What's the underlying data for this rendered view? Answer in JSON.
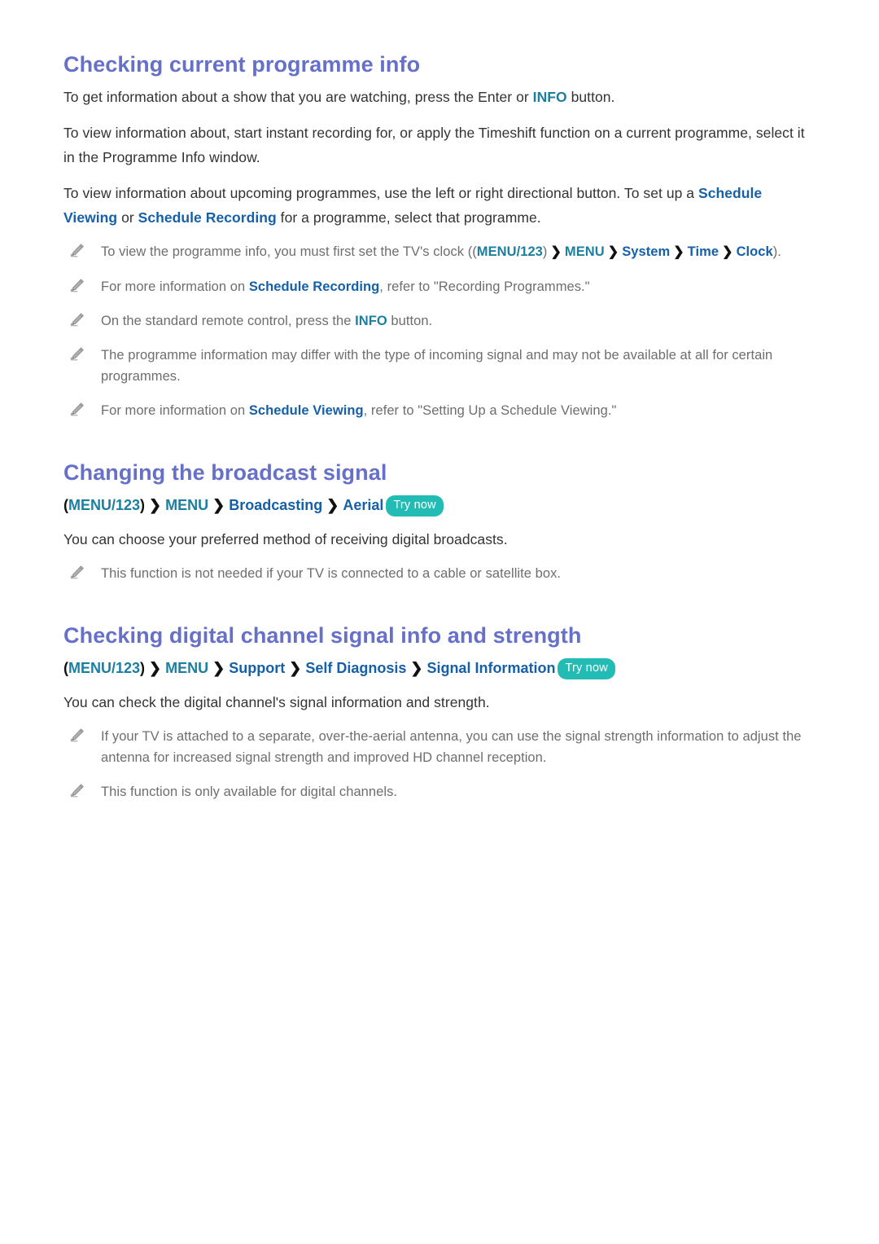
{
  "document": {
    "sections": [
      {
        "id": "checking-current-programme-info",
        "title": "Checking current programme info",
        "paragraphs": [
          "To get information about a show that you are watching, press the Enter or INFO button.",
          "To view information about, start instant recording for, or apply the Timeshift function on a current programme, select it in the Programme Info window.",
          "To view information about upcoming programmes, use the left or right directional button. To set up a Schedule Viewing or Schedule Recording for a programme, select that programme."
        ],
        "p1": {
          "pre": "To get information about a show that you are watching, press the Enter or ",
          "link": "INFO",
          "post": " button."
        },
        "p2": {
          "text": "To view information about, start instant recording for, or apply the Timeshift function on a current programme, select it in the Programme Info window."
        },
        "p3": {
          "pre": "To view information about upcoming programmes, use the left or right directional button. To set up a ",
          "link1": "Schedule Viewing",
          "mid": " or ",
          "link2": "Schedule Recording",
          "post": " for a programme, select that programme."
        },
        "notes": [
          {
            "pre": "To view the programme info, you must first set the TV's clock ((",
            "tok1": "MENU/123",
            "close1": ")",
            "chev1": "❯",
            "tok2": "MENU",
            "chev2": "❯",
            "tok3": "System",
            "chev3": "❯",
            "tok4": "Time",
            "chev4": "❯",
            "tok5": "Clock",
            "post": ")."
          },
          {
            "pre": "For more information on ",
            "link": "Schedule Recording",
            "post": ", refer to \"Recording Programmes.\""
          },
          {
            "pre": "On the standard remote control, press the ",
            "link": "INFO",
            "post": " button."
          },
          {
            "pre": "The programme information may differ with the type of incoming signal and may not be available at all for certain programmes.",
            "link": "",
            "post": ""
          },
          {
            "pre": "For more information on ",
            "link": "Schedule Viewing",
            "post": ", refer to \"Setting Up a Schedule Viewing.\""
          }
        ]
      },
      {
        "id": "changing-the-broadcast-signal",
        "title": "Changing the broadcast signal",
        "menu_path": {
          "open_paren": "(",
          "tokens": [
            "MENU/123",
            "MENU",
            "Broadcasting",
            "Aerial"
          ],
          "close_paren": ")",
          "separator": "❯",
          "try_now": "Try now"
        },
        "paragraph": "You can choose your preferred method of receiving digital broadcasts.",
        "notes": [
          {
            "pre": "This function is not needed if your TV is connected to a cable or satellite box.",
            "link": "",
            "post": ""
          }
        ]
      },
      {
        "id": "checking-digital-channel-signal-info-and-strength",
        "title": "Checking digital channel signal info and strength",
        "menu_path": {
          "open_paren": "(",
          "tokens": [
            "MENU/123",
            "MENU",
            "Support",
            "Self Diagnosis",
            "Signal Information"
          ],
          "close_paren": ")",
          "separator": "❯",
          "try_now": "Try now"
        },
        "paragraph": "You can check the digital channel's signal information and strength.",
        "notes": [
          {
            "pre": "If your TV is attached to a separate, over-the-aerial antenna, you can use the signal strength information to adjust the antenna for increased signal strength and improved HD channel reception.",
            "link": "",
            "post": ""
          },
          {
            "pre": "This function is only available for digital channels.",
            "link": "",
            "post": ""
          }
        ]
      }
    ]
  },
  "colors": {
    "heading": "#6670c8",
    "link_teal": "#1b7fa0",
    "link_blue": "#1560a8",
    "body_text": "#333333",
    "note_text": "#6e6e6e",
    "try_now_bg": "#23bcb4",
    "try_now_text": "#ffffff",
    "background": "#ffffff"
  },
  "icons": {
    "note_bullet": "pencil-icon"
  }
}
